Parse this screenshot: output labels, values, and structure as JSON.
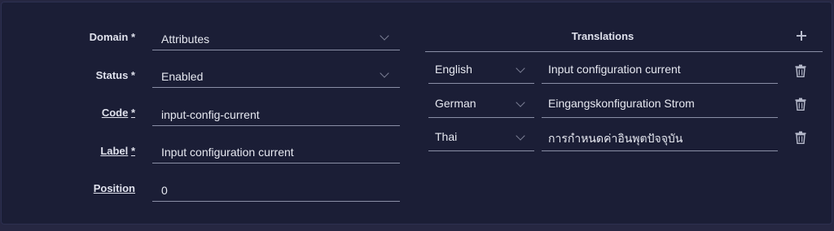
{
  "form": {
    "domain": {
      "label": "Domain *",
      "value": "Attributes"
    },
    "status": {
      "label": "Status *",
      "value": "Enabled"
    },
    "code": {
      "label_text": "Code",
      "label_req": "*",
      "value": "input-config-current"
    },
    "label_field": {
      "label_text": "Label",
      "label_req": "*",
      "value": "Input configuration current"
    },
    "position": {
      "label_text": "Position",
      "value": "0"
    }
  },
  "translations": {
    "title": "Translations",
    "rows": [
      {
        "language": "English",
        "text": "Input configuration current"
      },
      {
        "language": "German",
        "text": "Eingangskonfiguration Strom"
      },
      {
        "language": "Thai",
        "text": "การกำหนดค่าอินพุตปัจจุบัน"
      }
    ]
  },
  "icons": {
    "add": "plus-icon",
    "delete": "trash-icon",
    "dropdown": "chevron-down-icon"
  }
}
